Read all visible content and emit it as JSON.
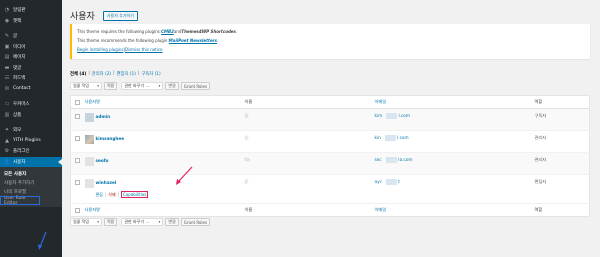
{
  "sidebar": {
    "items": [
      {
        "label": "알림판",
        "icon": "dashboard-icon"
      },
      {
        "label": "젯팩",
        "icon": "jetpack-icon"
      },
      {
        "label": "글",
        "icon": "pin-icon"
      },
      {
        "label": "미디어",
        "icon": "media-icon"
      },
      {
        "label": "페이지",
        "icon": "page-icon"
      },
      {
        "label": "댓글",
        "icon": "comment-icon"
      },
      {
        "label": "피드백",
        "icon": "feedback-icon"
      },
      {
        "label": "Contact",
        "icon": "mail-icon"
      },
      {
        "label": "우커머스",
        "icon": "woocommerce-icon"
      },
      {
        "label": "상품",
        "icon": "product-icon"
      },
      {
        "label": "외모",
        "icon": "appearance-icon"
      },
      {
        "label": "YITH Plugins",
        "icon": "yith-icon"
      },
      {
        "label": "플러그인",
        "icon": "plugin-icon"
      },
      {
        "label": "사용자",
        "icon": "users-icon",
        "active": true
      }
    ],
    "submenu": [
      "모든 사용자",
      "사용자 추가하기",
      "나의 프로필",
      "User Role Editor"
    ]
  },
  "header": {
    "title": "사용자",
    "add_button": "사용자 추가하기"
  },
  "notice": {
    "line1_pre": "This theme requires the following plugins: ",
    "line1_link1": "CMB2",
    "line1_mid": " and ",
    "line1_link2": "Themes4WP Shortcodes",
    "line1_post": ".",
    "line2_pre": "This theme recommends the following plugin: ",
    "line2_link": "MailPoet Newsletters",
    "line2_post": ".",
    "line3_link1": "Begin installing plugins",
    "line3_sep": " | ",
    "line3_link2": "Dismiss this notice"
  },
  "views": [
    {
      "label": "전체",
      "count": "(4)",
      "current": true
    },
    {
      "label": "관리자",
      "count": "(2)"
    },
    {
      "label": "편집자",
      "count": "(1)"
    },
    {
      "label": "구독자",
      "count": "(1)"
    }
  ],
  "bulk": {
    "bulk_action": "일괄 작업",
    "apply": "적용",
    "change_role": "권한 바꾸기 ...",
    "change": "변경",
    "grant_roles": "Grant Roles"
  },
  "table": {
    "headers": {
      "username": "사용자명",
      "name": "이름",
      "email": "이메일",
      "role": "역할"
    },
    "rows": [
      {
        "username": "admin",
        "name": "상",
        "email": "kim",
        "email_tail": "l.com",
        "role": "구독자"
      },
      {
        "username": "kimsanghee",
        "name": "상",
        "email": "kin",
        "email_tail": "l.com",
        "role": "관리자"
      },
      {
        "username": "seofu",
        "name": "Sa",
        "email": "sec",
        "email_tail": "ra.com",
        "role": "관리자"
      },
      {
        "username": "winhazel",
        "name": "준",
        "email": "ayc",
        "email_tail": "t",
        "role": "편집자",
        "actions": {
          "edit": "편집",
          "sep": "|",
          "delete": "삭제",
          "caps": "Capabilities"
        }
      }
    ]
  },
  "colors": {
    "sidebar_bg": "#23282d",
    "active_menu": "#0073aa",
    "notice_border": "#ffb900",
    "highlight": "#e0245e"
  }
}
